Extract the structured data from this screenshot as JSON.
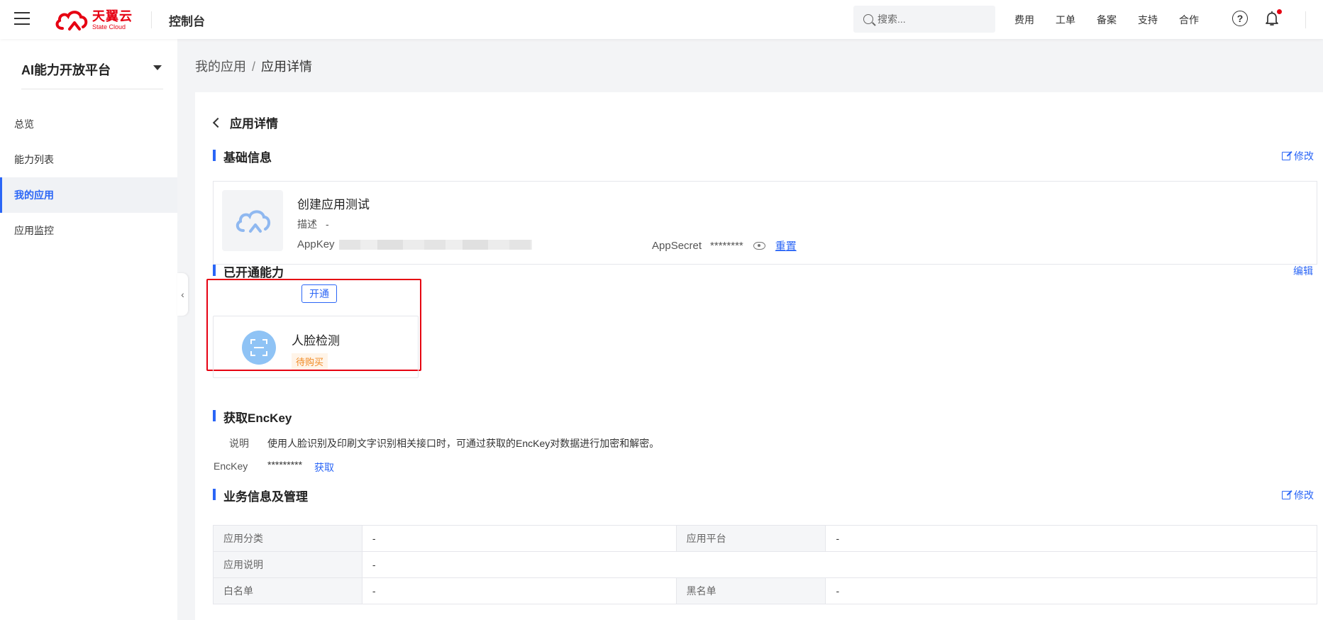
{
  "header": {
    "logo_cn": "天翼云",
    "logo_en": "State Cloud",
    "console_title": "控制台",
    "search_placeholder": "搜索...",
    "nav": [
      "费用",
      "工单",
      "备案",
      "支持",
      "合作"
    ],
    "help_glyph": "?"
  },
  "sidebar": {
    "platform": "AI能力开放平台",
    "items": [
      {
        "label": "总览"
      },
      {
        "label": "能力列表"
      },
      {
        "label": "我的应用"
      },
      {
        "label": "应用监控"
      }
    ],
    "active_index": 2,
    "collapse_glyph": "‹"
  },
  "breadcrumb": {
    "parent": "我的应用",
    "separator": "/",
    "current": "应用详情"
  },
  "page": {
    "title": "应用详情",
    "basic": {
      "title": "基础信息",
      "edit_label": "修改",
      "app_name": "创建应用测试",
      "desc_label": "描述",
      "desc_value": "-",
      "appkey_label": "AppKey",
      "appsecret_label": "AppSecret",
      "appsecret_value": "********",
      "reset_label": "重置"
    },
    "capabilities": {
      "title": "已开通能力",
      "open_label": "开通",
      "edit_label": "编辑",
      "items": [
        {
          "name": "人脸检测",
          "status": "待购买"
        }
      ]
    },
    "enckey": {
      "title": "获取EncKey",
      "desc_label": "说明",
      "desc_text": "使用人脸识别及印刷文字识别相关接口时，可通过获取的EncKey对数据进行加密和解密。",
      "label": "EncKey",
      "value": "*********",
      "get_label": "获取"
    },
    "business": {
      "title": "业务信息及管理",
      "edit_label": "修改",
      "rows": [
        {
          "l1": "应用分类",
          "v1": "-",
          "l2": "应用平台",
          "v2": "-"
        },
        {
          "l1": "应用说明",
          "v1": "-"
        },
        {
          "l1": "白名单",
          "v1": "-",
          "l2": "黑名单",
          "v2": "-"
        }
      ]
    }
  },
  "colors": {
    "accent": "#2b66f6",
    "brand": "#e60012",
    "pending": "#f08a24",
    "highlight": "#e60012"
  }
}
